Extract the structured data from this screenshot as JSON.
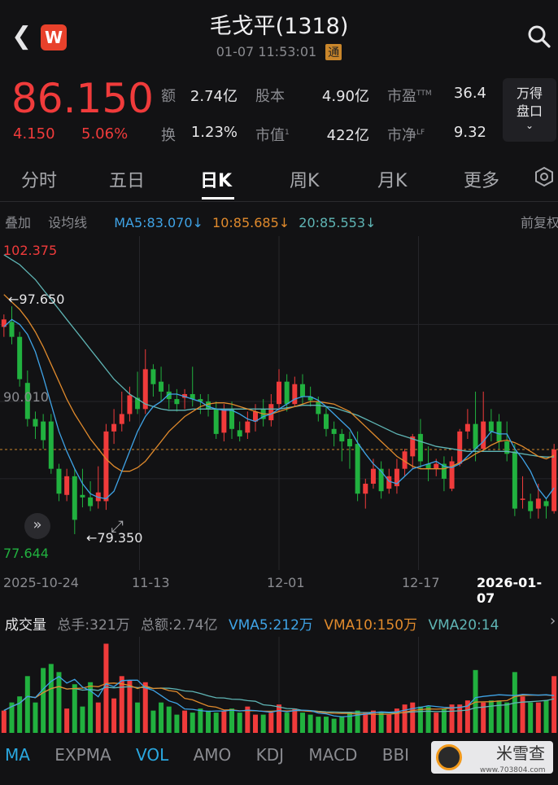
{
  "header": {
    "title": "毛戈平(1318)",
    "datetime": "01-07 11:53:01",
    "tong_badge": "通",
    "logo_letter": "W"
  },
  "quote": {
    "price": "86.150",
    "change": "4.150",
    "change_pct": "5.06%",
    "fields": [
      {
        "label": "额",
        "value": "2.74亿"
      },
      {
        "label": "股本",
        "value": "4.90亿"
      },
      {
        "label": "市盈",
        "sup": "TTM",
        "value": "36.4"
      },
      {
        "label": "换",
        "value": "1.23%"
      },
      {
        "label": "市值",
        "sup": "1",
        "value": "422亿"
      },
      {
        "label": "市净",
        "sup": "LF",
        "value": "9.32"
      }
    ],
    "wande_btn": [
      "万得",
      "盘口"
    ]
  },
  "tabs": [
    "分时",
    "五日",
    "日K",
    "周K",
    "月K",
    "更多"
  ],
  "active_tab": 2,
  "ma_row": {
    "overlay": "叠加",
    "set_ma": "设均线",
    "ma5": "MA5:83.070↓",
    "ma10": "10:85.685↓",
    "ma20": "20:85.553↓",
    "fq": "前复权"
  },
  "colors": {
    "up": "#f03b3b",
    "down": "#21b13f",
    "ma5": "#3fa3e6",
    "ma10": "#e08a2c",
    "ma20": "#5fb5b5"
  },
  "chart_data": {
    "type": "candlestick",
    "y_labels": [
      "102.375",
      "90.010",
      "77.644"
    ],
    "annotations": {
      "high": "←97.650",
      "low": "←79.350"
    },
    "last_price_line": 86.15,
    "dates": [
      "2025-10-24",
      "11-13",
      "12-01",
      "12-17",
      "2026-01-07"
    ],
    "candles": [
      [
        96.0,
        96.6,
        95.2,
        97.0
      ],
      [
        96.4,
        95.2,
        94.6,
        97.65
      ],
      [
        95.2,
        91.8,
        91.2,
        95.6
      ],
      [
        91.5,
        88.6,
        88.0,
        92.5
      ],
      [
        88.6,
        88.0,
        87.0,
        89.2
      ],
      [
        88.4,
        86.9,
        86.2,
        89.0
      ],
      [
        88.4,
        84.6,
        84.2,
        89.0
      ],
      [
        84.6,
        82.6,
        82.0,
        85.0
      ],
      [
        82.5,
        84.0,
        82.0,
        84.6
      ],
      [
        84.0,
        80.5,
        79.35,
        84.6
      ],
      [
        82.5,
        82.3,
        81.5,
        84.6
      ],
      [
        82.3,
        81.6,
        81.2,
        83.6
      ],
      [
        82.0,
        82.7,
        81.4,
        84.8
      ],
      [
        82.0,
        87.6,
        81.3,
        88.2
      ],
      [
        87.6,
        88.2,
        86.6,
        89.4
      ],
      [
        88.2,
        89.0,
        87.6,
        90.8
      ],
      [
        89.0,
        90.5,
        88.4,
        91.2
      ],
      [
        90.3,
        89.4,
        89.0,
        92.4
      ],
      [
        89.4,
        92.6,
        89.0,
        94.2
      ],
      [
        92.6,
        91.4,
        90.4,
        93.0
      ],
      [
        91.6,
        90.8,
        90.0,
        92.8
      ],
      [
        90.8,
        90.2,
        89.4,
        91.4
      ],
      [
        90.2,
        89.8,
        89.2,
        91.0
      ],
      [
        90.3,
        90.6,
        89.4,
        91.0
      ],
      [
        90.6,
        90.2,
        89.6,
        92.8
      ],
      [
        90.2,
        90.0,
        89.0,
        90.6
      ],
      [
        90.0,
        89.4,
        88.8,
        90.6
      ],
      [
        89.4,
        87.4,
        87.0,
        90.0
      ],
      [
        87.5,
        89.4,
        86.8,
        89.8
      ],
      [
        89.4,
        87.8,
        87.0,
        90.0
      ],
      [
        87.7,
        87.2,
        86.8,
        88.4
      ],
      [
        87.5,
        88.4,
        87.0,
        89.2
      ],
      [
        88.4,
        89.2,
        87.6,
        89.8
      ],
      [
        89.4,
        88.6,
        88.0,
        90.2
      ],
      [
        88.5,
        89.8,
        88.0,
        90.6
      ],
      [
        89.8,
        91.6,
        89.2,
        92.6
      ],
      [
        91.6,
        89.8,
        89.2,
        92.2
      ],
      [
        89.8,
        91.4,
        89.6,
        92.0
      ],
      [
        91.4,
        90.4,
        89.8,
        92.2
      ],
      [
        90.4,
        90.1,
        89.6,
        91.2
      ],
      [
        90.0,
        89.0,
        88.4,
        90.4
      ],
      [
        89.0,
        87.8,
        87.2,
        89.6
      ],
      [
        87.8,
        87.4,
        86.4,
        88.4
      ],
      [
        87.4,
        86.8,
        85.2,
        87.8
      ],
      [
        87.0,
        86.4,
        84.6,
        87.6
      ],
      [
        86.6,
        82.6,
        82.0,
        87.6
      ],
      [
        82.6,
        83.4,
        81.4,
        83.8
      ],
      [
        83.4,
        84.6,
        83.0,
        85.4
      ],
      [
        84.6,
        82.8,
        82.2,
        85.2
      ],
      [
        83.0,
        84.0,
        82.6,
        84.6
      ],
      [
        83.2,
        84.6,
        82.6,
        85.4
      ],
      [
        84.6,
        86.0,
        84.0,
        86.2
      ],
      [
        85.6,
        87.2,
        84.6,
        87.4
      ],
      [
        87.4,
        85.2,
        84.6,
        88.6
      ],
      [
        85.0,
        84.6,
        83.6,
        86.4
      ],
      [
        84.6,
        85.0,
        84.0,
        85.4
      ],
      [
        85.0,
        83.8,
        82.8,
        85.6
      ],
      [
        83.0,
        85.2,
        82.8,
        85.6
      ],
      [
        85.0,
        87.6,
        84.8,
        87.8
      ],
      [
        87.6,
        88.2,
        87.0,
        89.4
      ],
      [
        88.2,
        86.2,
        85.2,
        90.8
      ],
      [
        86.2,
        88.4,
        86.0,
        90.8
      ],
      [
        88.4,
        87.6,
        86.8,
        89.4
      ],
      [
        88.4,
        86.8,
        86.2,
        89.0
      ],
      [
        86.8,
        85.8,
        85.2,
        88.4
      ],
      [
        86.0,
        81.4,
        80.8,
        86.6
      ],
      [
        82.2,
        82.2,
        81.4,
        84.0
      ],
      [
        82.0,
        81.2,
        80.6,
        82.6
      ],
      [
        81.4,
        82.2,
        80.6,
        83.4
      ],
      [
        82.0,
        81.6,
        80.6,
        82.2
      ],
      [
        81.2,
        86.15,
        81.0,
        86.6
      ]
    ],
    "ma5": [
      96.0,
      96.6,
      96.2,
      95.4,
      94.0,
      92.0,
      89.8,
      87.6,
      86.0,
      84.6,
      83.4,
      82.6,
      82.3,
      82.2,
      82.8,
      84.4,
      86.0,
      87.6,
      88.8,
      89.6,
      90.0,
      90.6,
      90.6,
      90.4,
      90.2,
      90.0,
      89.6,
      89.4,
      89.3,
      89.3,
      89.0,
      88.6,
      88.4,
      88.8,
      89.0,
      89.4,
      89.8,
      90.2,
      90.4,
      90.4,
      90.1,
      89.6,
      89.0,
      88.4,
      87.8,
      86.7,
      85.8,
      85.0,
      84.4,
      83.6,
      83.4,
      84.0,
      84.6,
      84.8,
      85.0,
      85.2,
      84.8,
      84.7,
      85.0,
      85.6,
      86.2,
      86.8,
      87.6,
      87.4,
      87.4,
      86.2,
      85.4,
      84.4,
      83.0,
      82.2,
      83.07
    ],
    "ma10": [
      98.6,
      98.0,
      97.4,
      96.6,
      95.6,
      94.4,
      93.0,
      91.6,
      90.2,
      89.0,
      88.0,
      87.0,
      86.2,
      85.4,
      84.8,
      84.4,
      84.4,
      84.7,
      85.2,
      86.0,
      86.8,
      87.6,
      88.2,
      88.8,
      89.2,
      89.6,
      89.8,
      89.9,
      89.9,
      89.8,
      89.6,
      89.4,
      89.2,
      89.0,
      89.0,
      89.2,
      89.4,
      89.6,
      89.8,
      90.0,
      90.0,
      89.9,
      89.8,
      89.5,
      89.2,
      88.6,
      88.0,
      87.4,
      86.8,
      86.2,
      85.6,
      85.2,
      84.8,
      84.6,
      84.6,
      84.6,
      84.6,
      84.8,
      85.1,
      85.4,
      85.8,
      86.1,
      86.5,
      86.8,
      86.9,
      86.7,
      86.4,
      86.0,
      85.6,
      85.4,
      85.685
    ],
    "ma20": [
      101.8,
      101.4,
      101.0,
      100.4,
      99.8,
      99.0,
      98.2,
      97.4,
      96.6,
      95.8,
      95.0,
      94.2,
      93.4,
      92.6,
      91.8,
      91.2,
      90.6,
      90.2,
      89.8,
      89.6,
      89.4,
      89.3,
      89.3,
      89.3,
      89.4,
      89.4,
      89.4,
      89.4,
      89.4,
      89.4,
      89.4,
      89.4,
      89.4,
      89.4,
      89.4,
      89.4,
      89.5,
      89.6,
      89.7,
      89.7,
      89.7,
      89.6,
      89.5,
      89.3,
      89.1,
      88.9,
      88.6,
      88.3,
      88.0,
      87.7,
      87.4,
      87.2,
      87.0,
      86.8,
      86.6,
      86.4,
      86.3,
      86.2,
      86.1,
      86.0,
      86.0,
      86.0,
      86.0,
      86.0,
      86.0,
      85.9,
      85.8,
      85.7,
      85.6,
      85.55,
      85.553
    ]
  },
  "volume": {
    "label": "成交量",
    "total_hands": "总手:321万",
    "total_amount": "总额:2.74亿",
    "vma5": "VMA5:212万",
    "vma10": "VMA10:150万",
    "vma20": "VMA20:14",
    "bars": [
      220,
      300,
      360,
      560,
      300,
      640,
      680,
      600,
      240,
      480,
      260,
      500,
      300,
      880,
      340,
      560,
      520,
      300,
      500,
      220,
      300,
      260,
      180,
      220,
      200,
      240,
      220,
      200,
      220,
      240,
      200,
      260,
      180,
      180,
      200,
      280,
      200,
      240,
      200,
      180,
      160,
      160,
      140,
      160,
      200,
      220,
      200,
      220,
      200,
      180,
      240,
      280,
      300,
      260,
      260,
      200,
      240,
      280,
      280,
      320,
      620,
      300,
      320,
      320,
      300,
      600,
      360,
      300,
      300,
      320,
      560
    ]
  },
  "indicators": [
    "MA",
    "EXPMA",
    "VOL",
    "AMO",
    "KDJ",
    "MACD",
    "BBI"
  ],
  "active_indicator": 2,
  "watermark": {
    "text": "米雪查",
    "url": "www.703804.com",
    "partial": "RS"
  }
}
